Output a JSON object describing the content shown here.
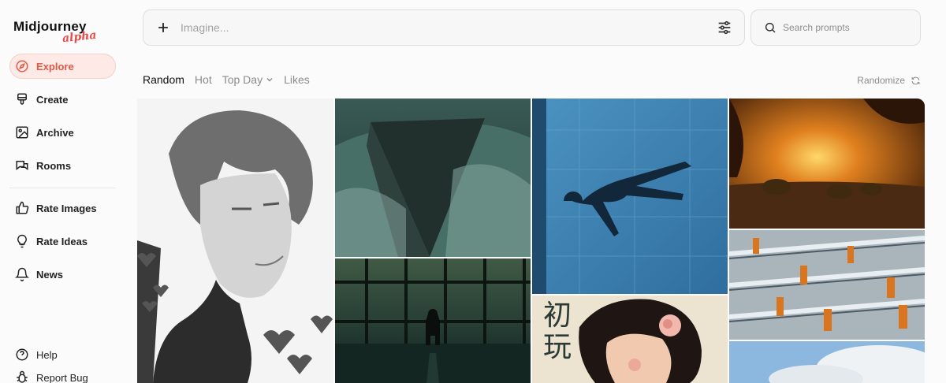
{
  "app": {
    "logo_text": "Midjourney",
    "logo_badge": "alpha"
  },
  "sidebar": {
    "items": [
      {
        "label": "Explore",
        "icon": "compass-icon",
        "active": true
      },
      {
        "label": "Create",
        "icon": "brush-icon"
      },
      {
        "label": "Archive",
        "icon": "image-icon"
      },
      {
        "label": "Rooms",
        "icon": "chat-icon"
      },
      {
        "label": "Rate Images",
        "icon": "thumbs-up-icon"
      },
      {
        "label": "Rate Ideas",
        "icon": "lightbulb-icon"
      },
      {
        "label": "News",
        "icon": "bell-icon"
      }
    ],
    "bottom": [
      {
        "label": "Help",
        "icon": "question-icon"
      },
      {
        "label": "Report Bug",
        "icon": "bug-icon"
      }
    ]
  },
  "imagine": {
    "placeholder": "Imagine..."
  },
  "search": {
    "placeholder": "Search prompts"
  },
  "tabs": [
    {
      "label": "Random",
      "active": true
    },
    {
      "label": "Hot"
    },
    {
      "label": "Top Day",
      "has_dropdown": true
    },
    {
      "label": "Likes"
    }
  ],
  "randomize_label": "Randomize",
  "colors": {
    "accent": "#e05a46",
    "accent_bg": "#fde9e6"
  },
  "gallery": {
    "poster_text": "初玩"
  }
}
